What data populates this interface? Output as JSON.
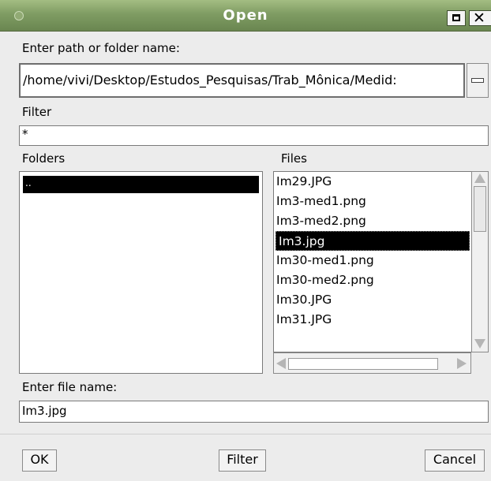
{
  "window": {
    "title": "Open"
  },
  "path": {
    "label": "Enter path or folder name:",
    "value": "/home/vivi/Desktop/Estudos_Pesquisas/Trab_Mônica/Medid:"
  },
  "filter": {
    "label": "Filter",
    "value": "*"
  },
  "folders": {
    "label": "Folders",
    "items": [
      ".."
    ],
    "selected": 0
  },
  "files": {
    "label": "Files",
    "items": [
      "Im29.JPG",
      "Im3-med1.png",
      "Im3-med2.png",
      "Im3.jpg",
      "Im30-med1.png",
      "Im30-med2.png",
      "Im30.JPG",
      "Im31.JPG"
    ],
    "selected": 3
  },
  "filename": {
    "label": "Enter file name:",
    "value": "Im3.jpg"
  },
  "buttons": {
    "ok": "OK",
    "filter": "Filter",
    "cancel": "Cancel"
  },
  "colors": {
    "titlebar": "#7f9c63",
    "selection": "#000000",
    "background": "#ececec"
  },
  "icons": {
    "maximize": "maximize-icon",
    "close": "close-icon",
    "window_menu": "window-menu-icon"
  }
}
